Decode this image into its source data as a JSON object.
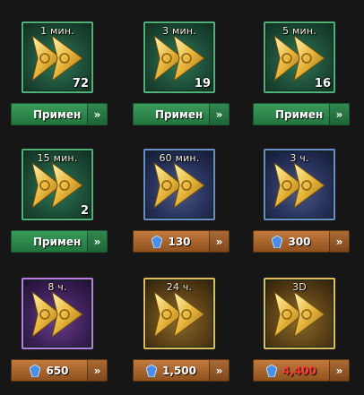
{
  "items": [
    {
      "time": "1 мин.",
      "count": "72",
      "style": "green",
      "action": "use",
      "label": "Примен"
    },
    {
      "time": "3 мин.",
      "count": "19",
      "style": "green",
      "action": "use",
      "label": "Примен"
    },
    {
      "time": "5 мин.",
      "count": "16",
      "style": "green",
      "action": "use",
      "label": "Примен"
    },
    {
      "time": "15 мин.",
      "count": "2",
      "style": "green",
      "action": "use",
      "label": "Примен"
    },
    {
      "time": "60 мин.",
      "count": "",
      "style": "blue",
      "action": "buy",
      "price": "130"
    },
    {
      "time": "3 ч.",
      "count": "",
      "style": "blue",
      "action": "buy",
      "price": "300"
    },
    {
      "time": "8 ч.",
      "count": "",
      "style": "purple",
      "action": "buy",
      "price": "650"
    },
    {
      "time": "24 ч.",
      "count": "",
      "style": "gold",
      "action": "buy",
      "price": "1,500"
    },
    {
      "time": "3D",
      "count": "",
      "style": "gold",
      "action": "buy",
      "price": "4,400",
      "price_color": "#ff3b30"
    }
  ],
  "arrow_glyph": "»",
  "colors": {
    "use_button": "#2f8a4c",
    "buy_button": "#b06a30",
    "gem": "#4a8ee6",
    "insufficient_price": "#ff3b30"
  },
  "icons": {
    "speedup": "double-arrow-speedup-icon",
    "gem": "gem-icon",
    "arrow": "double-chevron-right-icon"
  }
}
